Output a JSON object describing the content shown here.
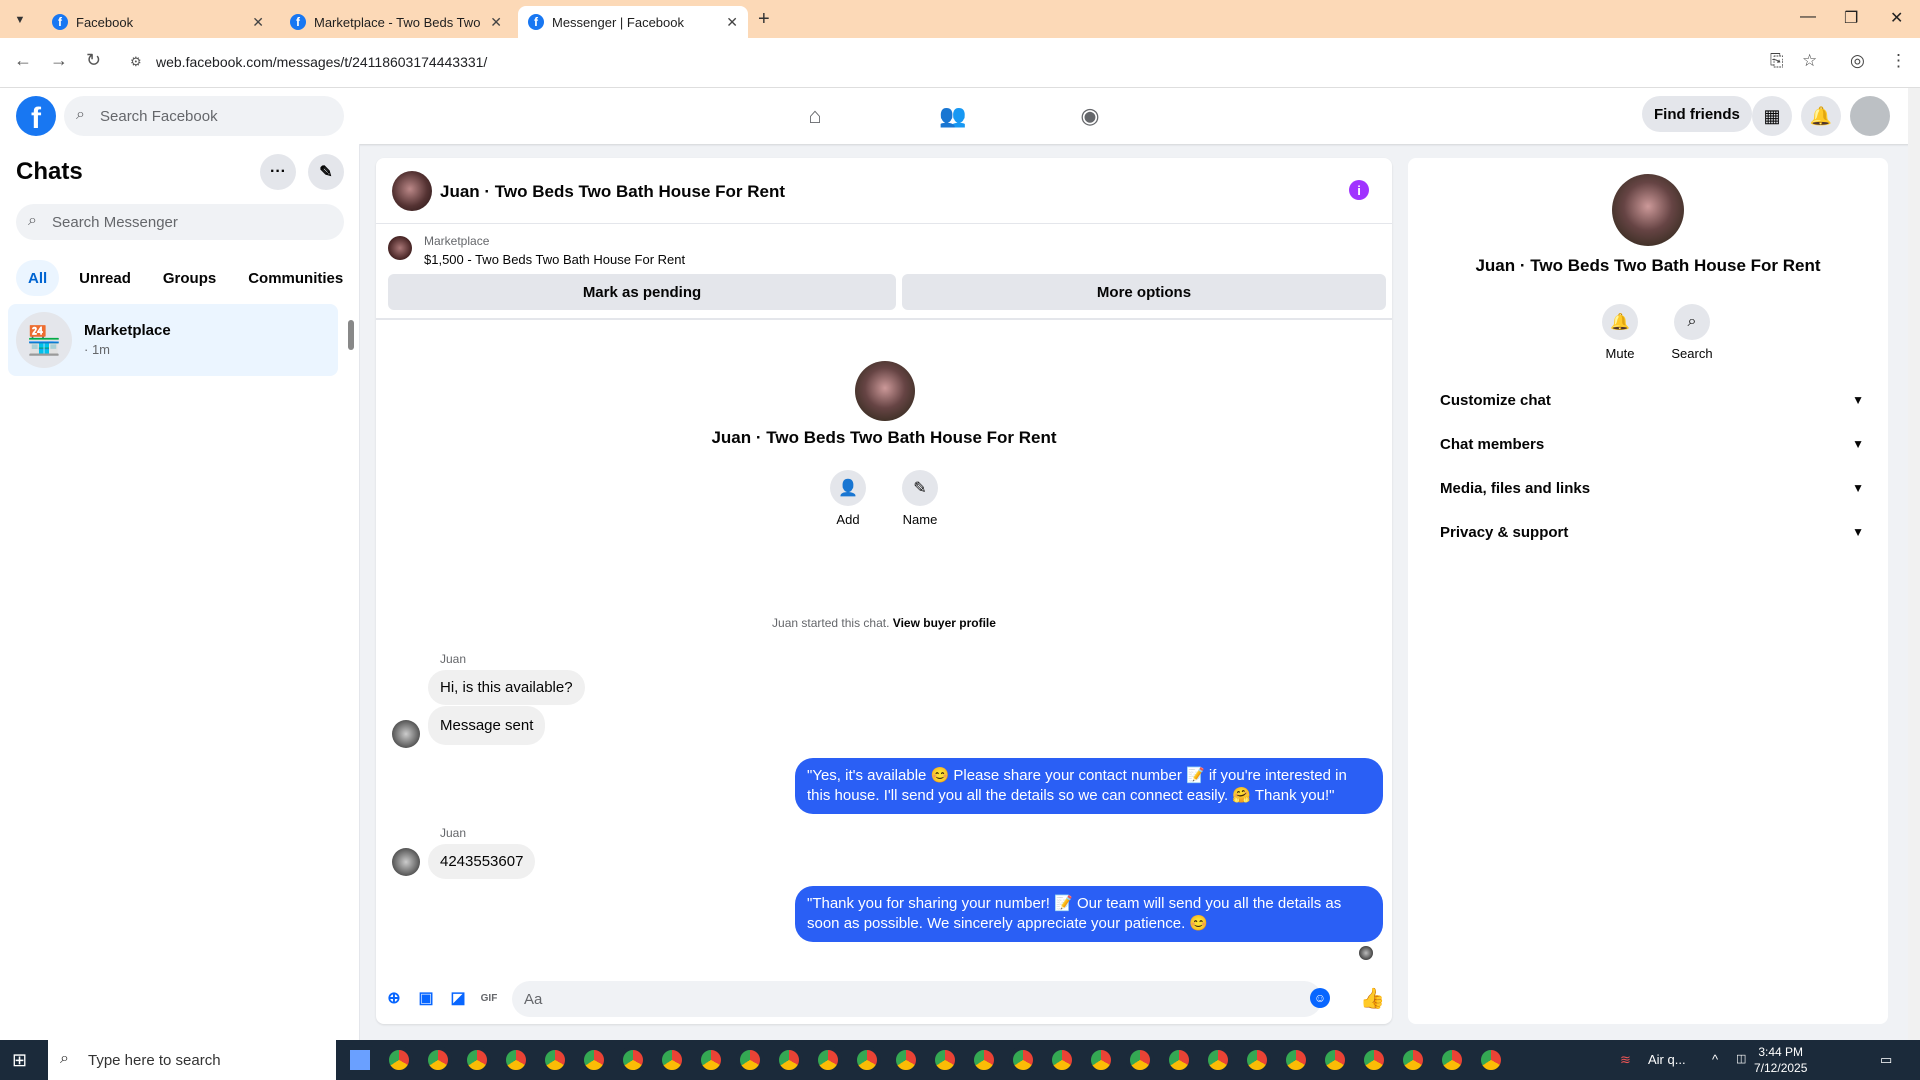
{
  "browser": {
    "tabs": [
      {
        "title": "Facebook",
        "active": false
      },
      {
        "title": "Marketplace - Two Beds Two Ba",
        "active": false
      },
      {
        "title": "Messenger | Facebook",
        "active": true
      }
    ],
    "url": "web.facebook.com/messages/t/24118603174443331/"
  },
  "fbnav": {
    "search_placeholder": "Search Facebook",
    "find_friends": "Find friends"
  },
  "chats": {
    "title": "Chats",
    "search_placeholder": "Search Messenger",
    "filters": [
      "All",
      "Unread",
      "Groups",
      "Communities"
    ],
    "items": [
      {
        "name": "Marketplace",
        "time": "· 1m"
      }
    ]
  },
  "conversation": {
    "title": "Juan · Two Beds Two Bath House For Rent",
    "marketplace_label": "Marketplace",
    "listing": "$1,500 - Two Beds Two Bath House For Rent",
    "mark_pending": "Mark as pending",
    "more_options": "More options",
    "intro_name": "Juan · Two Beds Two Bath House For Rent",
    "add_label": "Add",
    "name_label": "Name",
    "started_text": "Juan started this chat.",
    "view_buyer": "View buyer profile",
    "messages": [
      {
        "sender": "Juan",
        "text": "Hi, is this available?"
      },
      {
        "text": "Message sent"
      },
      {
        "text": "\"Yes, it's available 😊 Please share your contact number 📝 if you're interested in this house. I'll send you all the details so we can connect easily. 🤗 Thank you!\""
      },
      {
        "sender": "Juan",
        "text": "4243553607"
      },
      {
        "text": "\"Thank you for sharing your number! 📝 Our team will send you all the details as soon as possible. We sincerely appreciate your patience. 😊"
      }
    ],
    "composer_placeholder": "Aa"
  },
  "info_panel": {
    "name": "Juan · Two Beds Two Bath House For Rent",
    "mute": "Mute",
    "search": "Search",
    "sections": [
      "Customize chat",
      "Chat members",
      "Media, files and links",
      "Privacy & support"
    ]
  },
  "taskbar": {
    "search_placeholder": "Type here to search",
    "weather": "Air q...",
    "time": "3:44 PM",
    "date": "7/12/2025"
  },
  "colors": {
    "brand": "#1877f2",
    "outgoing_bubble": "#2a5ff5",
    "tab_bar": "#fcd9b7"
  }
}
